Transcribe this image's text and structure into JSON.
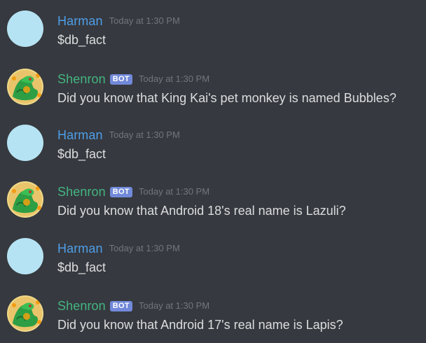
{
  "messages": [
    {
      "author": "Harman",
      "is_bot": false,
      "timestamp": "Today at 1:30 PM",
      "text": "$db_fact"
    },
    {
      "author": "Shenron",
      "is_bot": true,
      "badge": "BOT",
      "timestamp": "Today at 1:30 PM",
      "text": "Did you know that King Kai's pet monkey is named Bubbles?"
    },
    {
      "author": "Harman",
      "is_bot": false,
      "timestamp": "Today at 1:30 PM",
      "text": "$db_fact"
    },
    {
      "author": "Shenron",
      "is_bot": true,
      "badge": "BOT",
      "timestamp": "Today at 1:30 PM",
      "text": "Did you know that Android 18's real name is Lazuli?"
    },
    {
      "author": "Harman",
      "is_bot": false,
      "timestamp": "Today at 1:30 PM",
      "text": "$db_fact"
    },
    {
      "author": "Shenron",
      "is_bot": true,
      "badge": "BOT",
      "timestamp": "Today at 1:30 PM",
      "text": "Did you know that Android 17's real name is Lapis?"
    }
  ],
  "colors": {
    "background": "#36393f",
    "user_name": "#4f9ee8",
    "bot_name": "#43b581",
    "bot_badge": "#7289da",
    "timestamp": "#72767d",
    "message_text": "#dcddde"
  }
}
